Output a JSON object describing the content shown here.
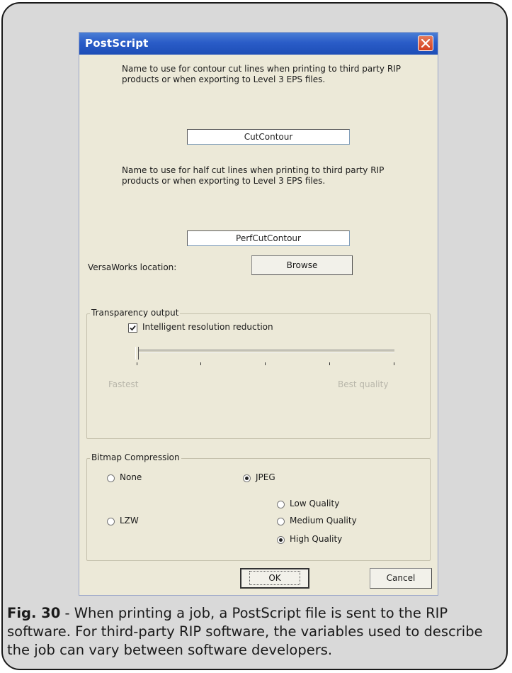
{
  "dialog": {
    "title": "PostScript",
    "contour_desc": "Name to use for contour cut lines when printing to third party RIP products or when exporting to Level 3 EPS files.",
    "contour_value": "CutContour",
    "halfcut_desc": "Name to use for half cut lines when printing to third party RIP products or when exporting to Level 3 EPS files.",
    "halfcut_value": "PerfCutContour",
    "versaworks_label": "VersaWorks location:",
    "browse_label": "Browse",
    "transparency": {
      "title": "Transparency output",
      "checkbox_label": "Intelligent resolution reduction",
      "checkbox_checked": true,
      "slider_min_label": "Fastest",
      "slider_max_label": "Best quality",
      "slider_value": 0
    },
    "bitmap": {
      "title": "Bitmap Compression",
      "none_label": "None",
      "lzw_label": "LZW",
      "jpeg_label": "JPEG",
      "low_label": "Low Quality",
      "medium_label": "Medium Quality",
      "high_label": "High Quality",
      "selected_method": "JPEG",
      "selected_quality": "High Quality"
    },
    "ok_label": "OK",
    "cancel_label": "Cancel"
  },
  "caption": {
    "fig_label": "Fig. 30",
    "text": " - When printing a job, a PostScript file is sent to the RIP software. For third-party RIP software, the variables used to describe the job can vary between software developers."
  },
  "colors": {
    "titlebar": "#2a5cc8",
    "dialog_bg": "#ece9d8",
    "card_bg": "#d9d9d9",
    "close": "#d44020"
  }
}
